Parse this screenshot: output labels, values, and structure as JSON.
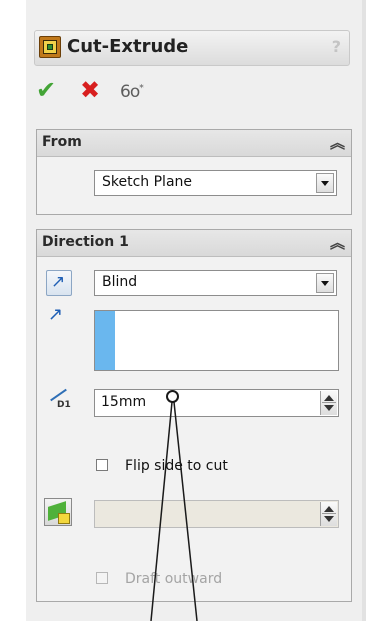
{
  "title": "Cut-Extrude",
  "help_icon": "?",
  "actions": {
    "ok_icon": "check-icon",
    "cancel_icon": "close-icon",
    "preview_icon": "preview-glasses-icon"
  },
  "from_group": {
    "title": "From",
    "start_condition": "Sketch Plane"
  },
  "direction1_group": {
    "title": "Direction 1",
    "end_condition": "Blind",
    "depth_value": "15mm",
    "depth_icon_label": "D1",
    "flip_side_label": "Flip side to cut",
    "flip_side_checked": false,
    "draft_label": "Draft outward",
    "draft_checked": false
  },
  "colors": {
    "ok": "#43a436",
    "cancel": "#d81f1f",
    "selection_accent": "#6ab7ee"
  }
}
